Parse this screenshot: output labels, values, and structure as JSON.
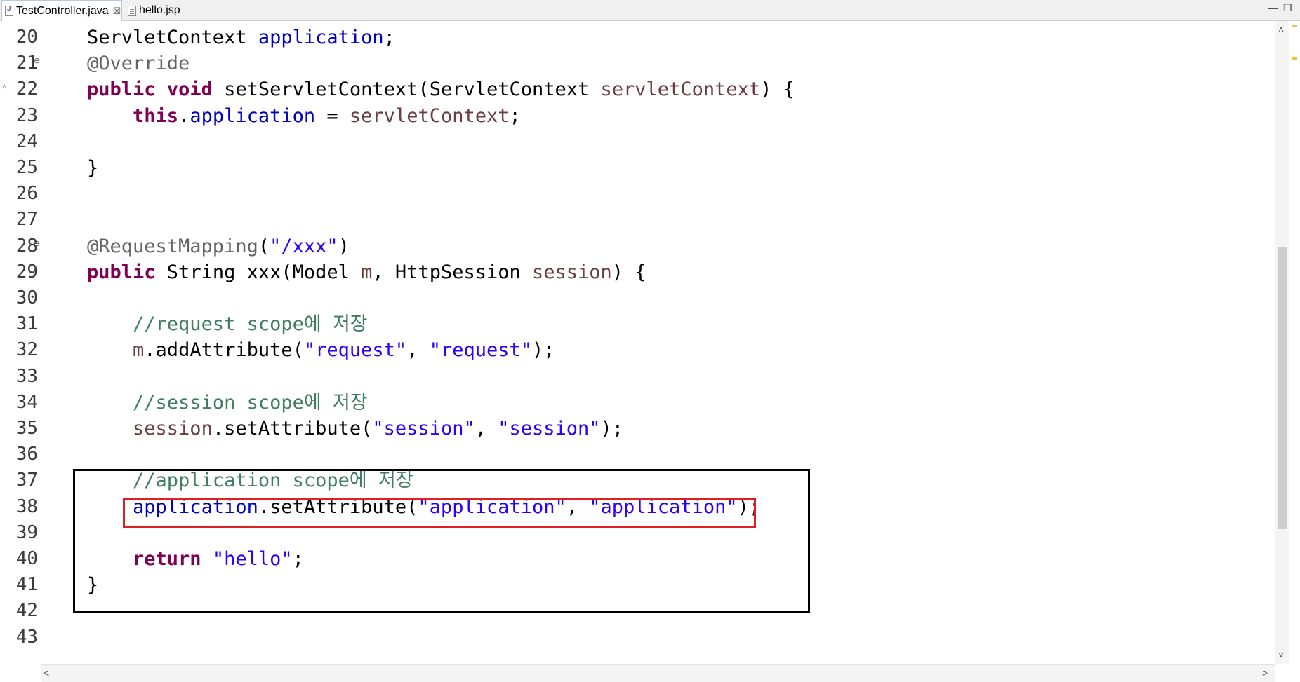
{
  "tabs": [
    {
      "label": "TestController.java",
      "active": true,
      "icon": "java-file-icon",
      "close_glyph": "☒"
    },
    {
      "label": "hello.jsp",
      "active": false,
      "icon": "jsp-file-icon"
    }
  ],
  "window_controls": {
    "minimize": "—",
    "restore": "❐"
  },
  "colors": {
    "keyword": "#7f0055",
    "field": "#0000c0",
    "string": "#2a00ff",
    "comment": "#3f7f5f",
    "annotation": "#646464",
    "parameter": "#6a3e3e",
    "highlight_black": "#000000",
    "highlight_red": "#e02020"
  },
  "code": {
    "lines": [
      {
        "n": "20",
        "tokens": [
          [
            "plain",
            "ServletContext "
          ],
          [
            "fld",
            "application"
          ],
          [
            "plain",
            ";"
          ]
        ]
      },
      {
        "n": "21",
        "fold": true,
        "tokens": [
          [
            "ann",
            "@Override"
          ]
        ]
      },
      {
        "n": "22",
        "override": true,
        "tokens": [
          [
            "kw",
            "public"
          ],
          [
            "plain",
            " "
          ],
          [
            "kw",
            "void"
          ],
          [
            "plain",
            " setServletContext(ServletContext "
          ],
          [
            "par",
            "servletContext"
          ],
          [
            "plain",
            ") {"
          ]
        ]
      },
      {
        "n": "23",
        "tokens": [
          [
            "plain",
            "    "
          ],
          [
            "kw",
            "this"
          ],
          [
            "plain",
            "."
          ],
          [
            "fld",
            "application"
          ],
          [
            "plain",
            " = "
          ],
          [
            "par",
            "servletContext"
          ],
          [
            "plain",
            ";"
          ]
        ]
      },
      {
        "n": "24",
        "tokens": []
      },
      {
        "n": "25",
        "tokens": [
          [
            "plain",
            "}"
          ]
        ]
      },
      {
        "n": "26",
        "tokens": []
      },
      {
        "n": "27",
        "tokens": []
      },
      {
        "n": "28",
        "fold": true,
        "tokens": [
          [
            "ann",
            "@RequestMapping"
          ],
          [
            "plain",
            "("
          ],
          [
            "str",
            "\"/xxx\""
          ],
          [
            "plain",
            ")"
          ]
        ]
      },
      {
        "n": "29",
        "tokens": [
          [
            "kw",
            "public"
          ],
          [
            "plain",
            " String xxx(Model "
          ],
          [
            "par",
            "m"
          ],
          [
            "plain",
            ", HttpSession "
          ],
          [
            "par",
            "session"
          ],
          [
            "plain",
            ") {"
          ]
        ]
      },
      {
        "n": "30",
        "tokens": []
      },
      {
        "n": "31",
        "tokens": [
          [
            "plain",
            "    "
          ],
          [
            "cmt",
            "//request scope에 저장"
          ]
        ]
      },
      {
        "n": "32",
        "tokens": [
          [
            "plain",
            "    "
          ],
          [
            "par",
            "m"
          ],
          [
            "plain",
            ".addAttribute("
          ],
          [
            "str",
            "\"request\""
          ],
          [
            "plain",
            ", "
          ],
          [
            "str",
            "\"request\""
          ],
          [
            "plain",
            ");"
          ]
        ]
      },
      {
        "n": "33",
        "tokens": []
      },
      {
        "n": "34",
        "tokens": [
          [
            "plain",
            "    "
          ],
          [
            "cmt",
            "//session scope에 저장"
          ]
        ]
      },
      {
        "n": "35",
        "tokens": [
          [
            "plain",
            "    "
          ],
          [
            "par",
            "session"
          ],
          [
            "plain",
            ".setAttribute("
          ],
          [
            "str",
            "\"session\""
          ],
          [
            "plain",
            ", "
          ],
          [
            "str",
            "\"session\""
          ],
          [
            "plain",
            ");"
          ]
        ]
      },
      {
        "n": "36",
        "tokens": []
      },
      {
        "n": "37",
        "tokens": [
          [
            "plain",
            "    "
          ],
          [
            "cmt",
            "//application scope에 저장"
          ]
        ]
      },
      {
        "n": "38",
        "tokens": [
          [
            "plain",
            "    "
          ],
          [
            "fld",
            "application"
          ],
          [
            "plain",
            ".setAttribute("
          ],
          [
            "str",
            "\"application\""
          ],
          [
            "plain",
            ", "
          ],
          [
            "str",
            "\"application\""
          ],
          [
            "plain",
            ");"
          ]
        ]
      },
      {
        "n": "39",
        "tokens": []
      },
      {
        "n": "40",
        "tokens": [
          [
            "plain",
            "    "
          ],
          [
            "kw",
            "return"
          ],
          [
            "plain",
            " "
          ],
          [
            "str",
            "\"hello\""
          ],
          [
            "plain",
            ";"
          ]
        ]
      },
      {
        "n": "41",
        "tokens": [
          [
            "plain",
            "}"
          ]
        ]
      },
      {
        "n": "42",
        "tokens": []
      },
      {
        "n": "43",
        "tokens": []
      }
    ]
  },
  "scrollbar": {
    "up_arrow": "˄",
    "down_arrow": "˅",
    "left_arrow": "˂",
    "right_arrow": "˃"
  }
}
